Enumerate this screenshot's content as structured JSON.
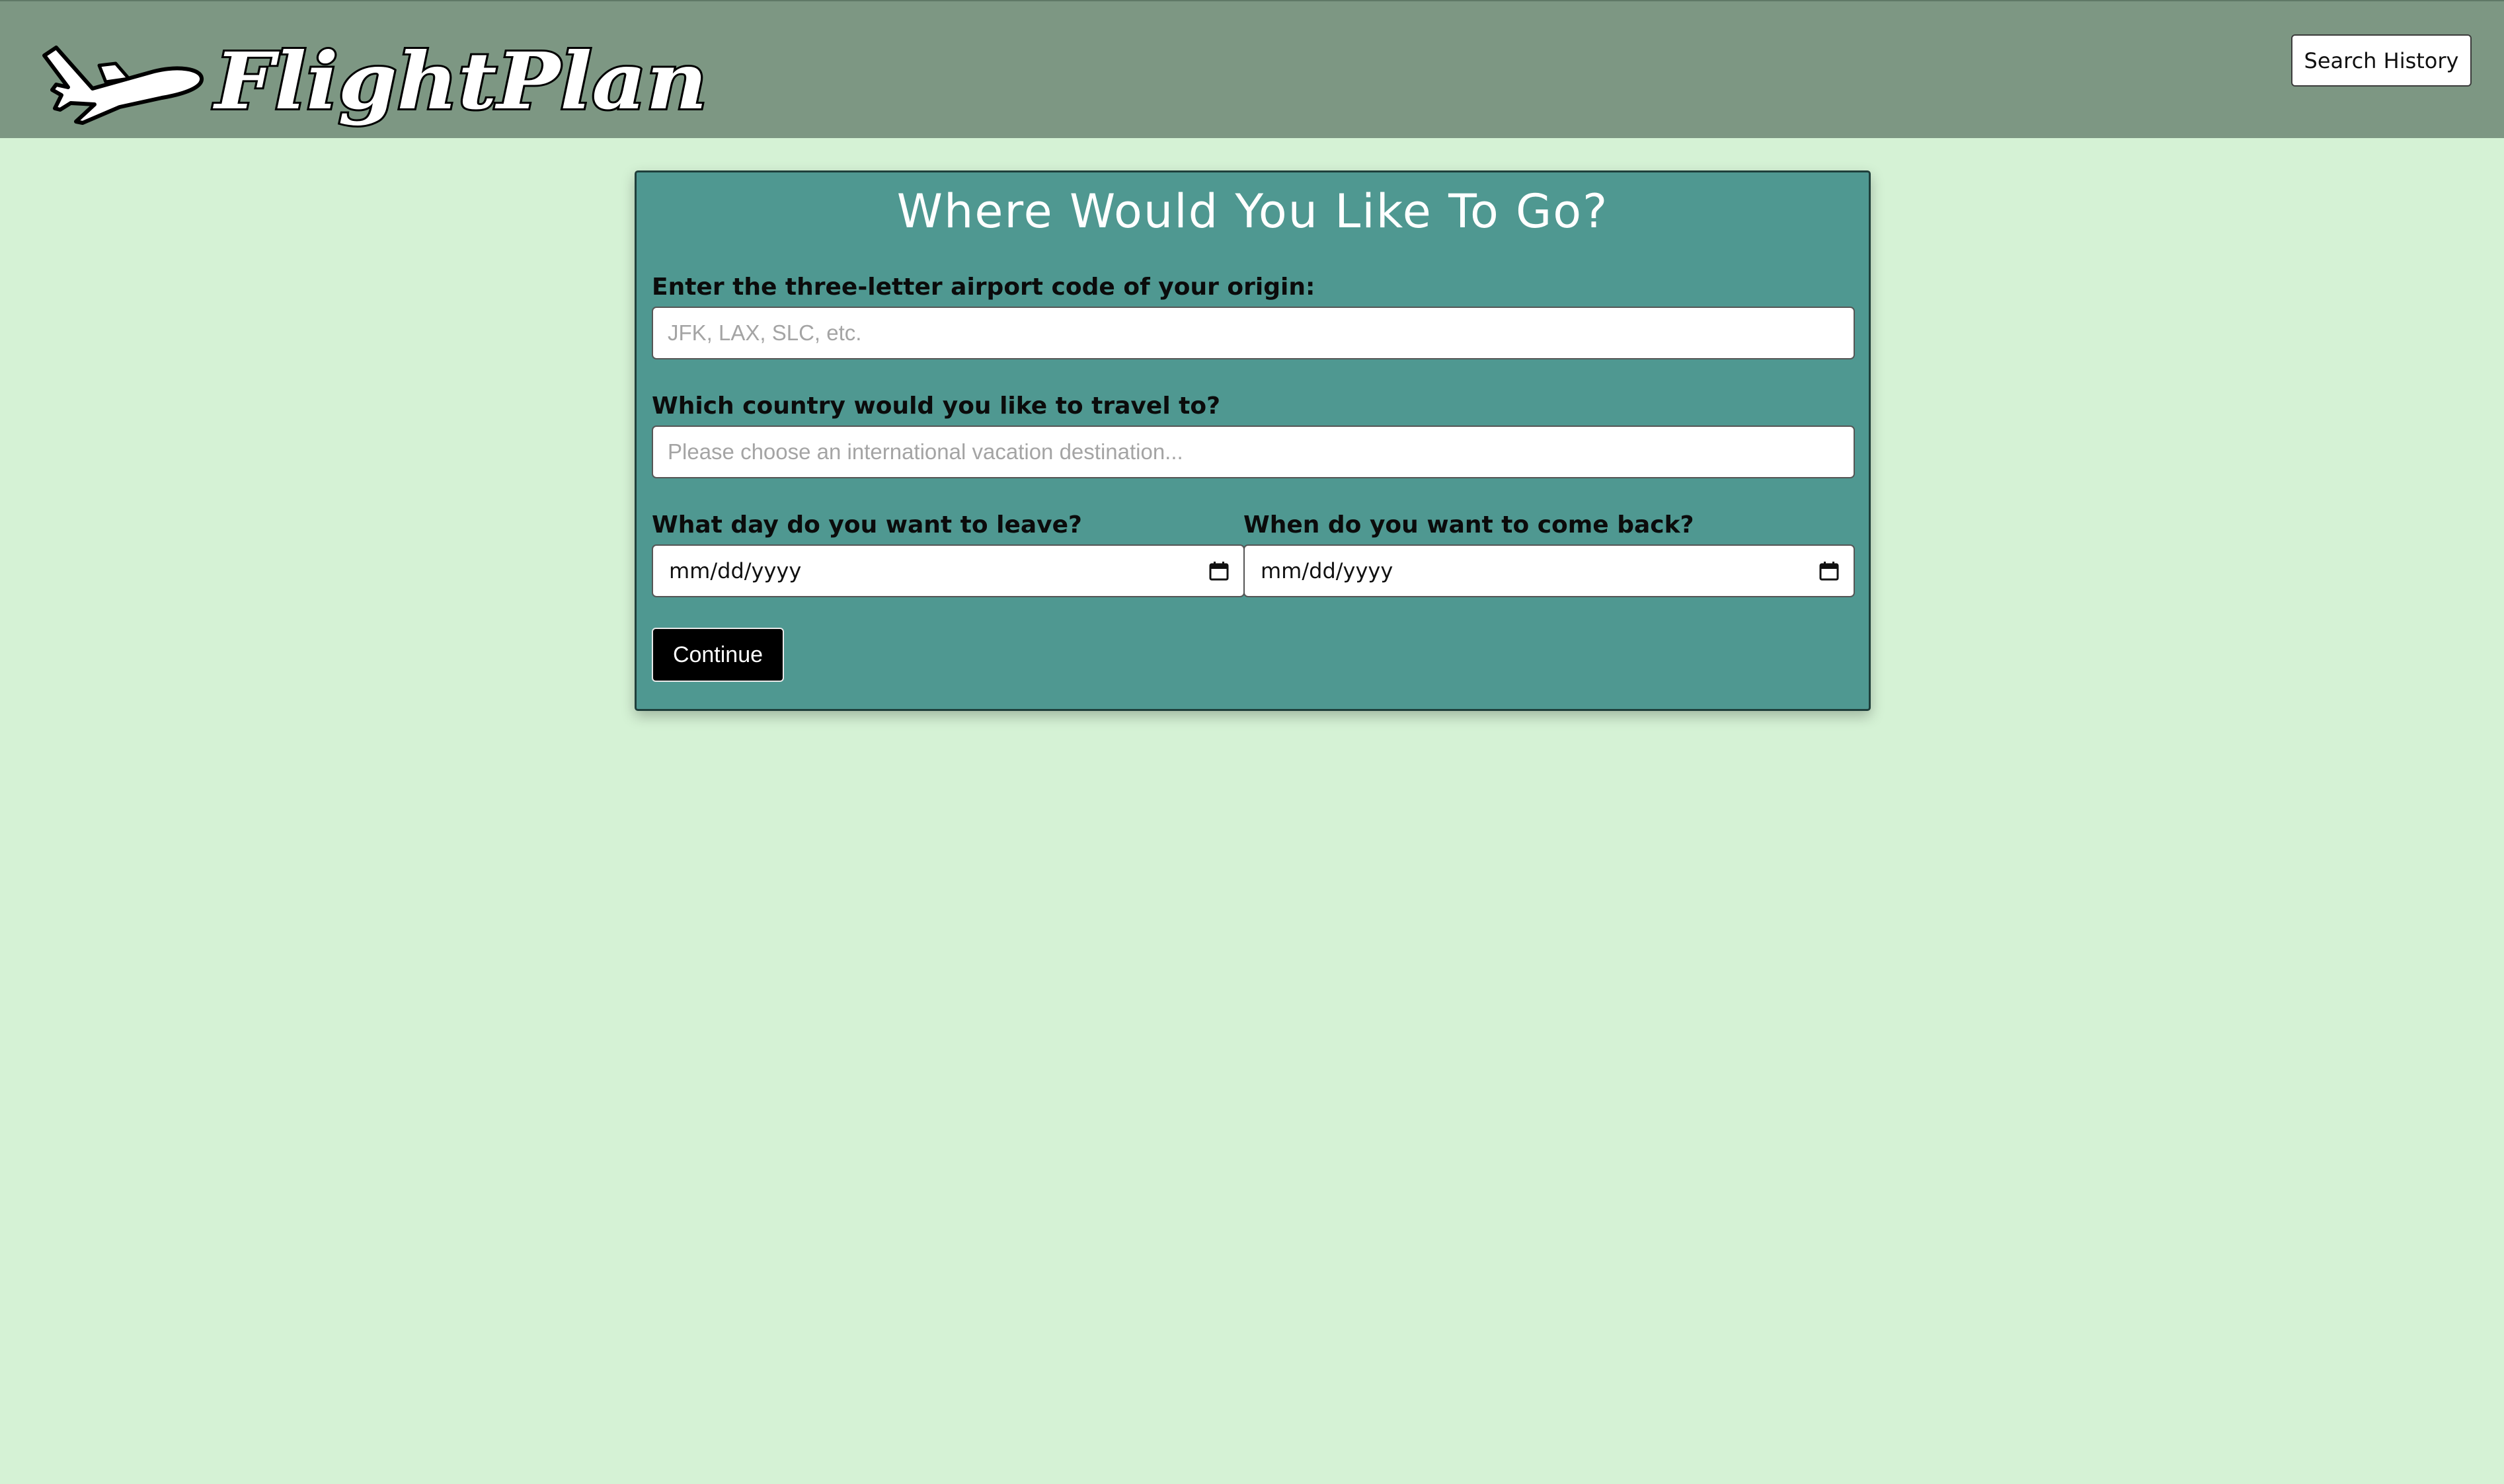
{
  "header": {
    "logo_text": "FlightPlan",
    "search_history_label": "Search History"
  },
  "form": {
    "title": "Where Would You Like To Go?",
    "origin": {
      "label": "Enter the three-letter airport code of your origin:",
      "placeholder": "JFK, LAX, SLC, etc.",
      "value": ""
    },
    "destination": {
      "label": "Which country would you like to travel to?",
      "placeholder": "Please choose an international vacation destination...",
      "value": ""
    },
    "depart": {
      "label": "What day do you want to leave?",
      "value": "mm/dd/yyyy"
    },
    "return": {
      "label": "When do you want to come back?",
      "value": "mm/dd/yyyy"
    },
    "continue_label": "Continue"
  },
  "colors": {
    "page_background": "#d5f2d5",
    "header_background": "#7d9783",
    "panel_background": "#4f9891",
    "button_background": "#000000"
  },
  "icons": [
    "airplane-icon",
    "calendar-icon"
  ]
}
